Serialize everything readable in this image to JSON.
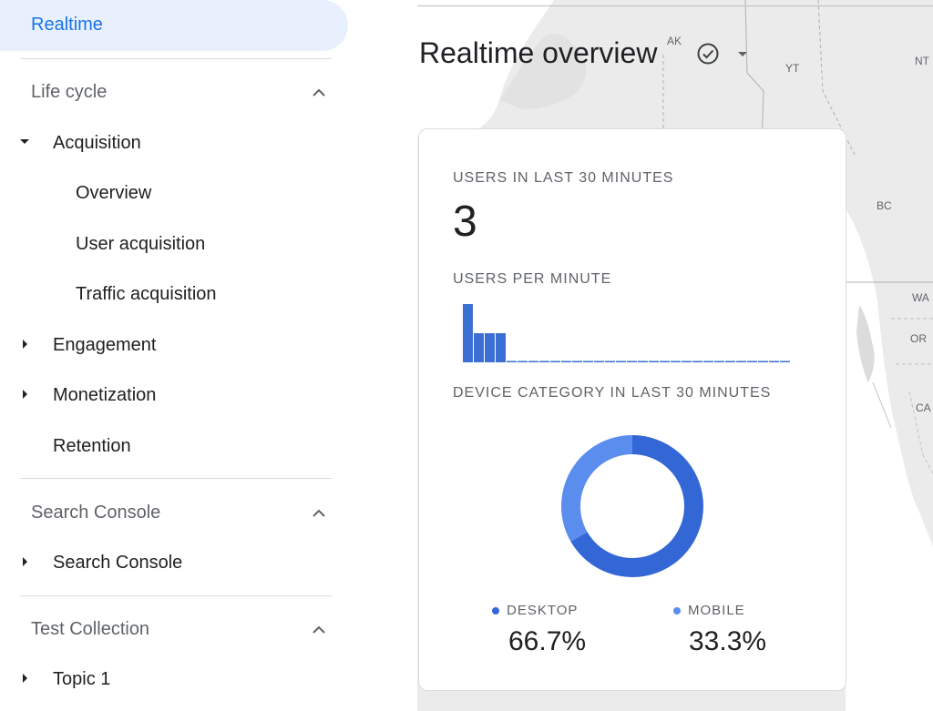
{
  "sidebar": {
    "active_item": "Realtime",
    "lifecycle": {
      "header": "Life cycle",
      "acquisition": "Acquisition",
      "acquisition_children": [
        "Overview",
        "User acquisition",
        "Traffic acquisition"
      ],
      "engagement": "Engagement",
      "monetization": "Monetization",
      "retention": "Retention"
    },
    "search_console": {
      "header": "Search Console",
      "item": "Search Console"
    },
    "test_collection": {
      "header": "Test Collection",
      "item": "Topic 1"
    }
  },
  "main": {
    "title": "Realtime overview",
    "map_labels": [
      "AK",
      "YT",
      "NT",
      "BC",
      "WA",
      "OR",
      "CA"
    ]
  },
  "card": {
    "users_30_label": "USERS IN LAST 30 MINUTES",
    "users_30_value": "3",
    "users_per_minute_label": "USERS PER MINUTE",
    "device_label": "DEVICE CATEGORY IN LAST 30 MINUTES"
  },
  "colors": {
    "accent": "#1a73e8",
    "bar": "#3b6fd4",
    "desktop": "#3367d6",
    "mobile": "#5b8def"
  },
  "chart_data": [
    {
      "type": "bar",
      "title": "USERS PER MINUTE",
      "values": [
        2,
        1,
        1,
        1,
        0,
        0,
        0,
        0,
        0,
        0,
        0,
        0,
        0,
        0,
        0,
        0,
        0,
        0,
        0,
        0,
        0,
        0,
        0,
        0,
        0,
        0,
        0,
        0,
        0,
        0
      ],
      "ylim": [
        0,
        2
      ]
    },
    {
      "type": "pie",
      "title": "DEVICE CATEGORY IN LAST 30 MINUTES",
      "categories": [
        "DESKTOP",
        "MOBILE"
      ],
      "values": [
        66.7,
        33.3
      ],
      "labels": [
        "66.7%",
        "33.3%"
      ]
    }
  ]
}
